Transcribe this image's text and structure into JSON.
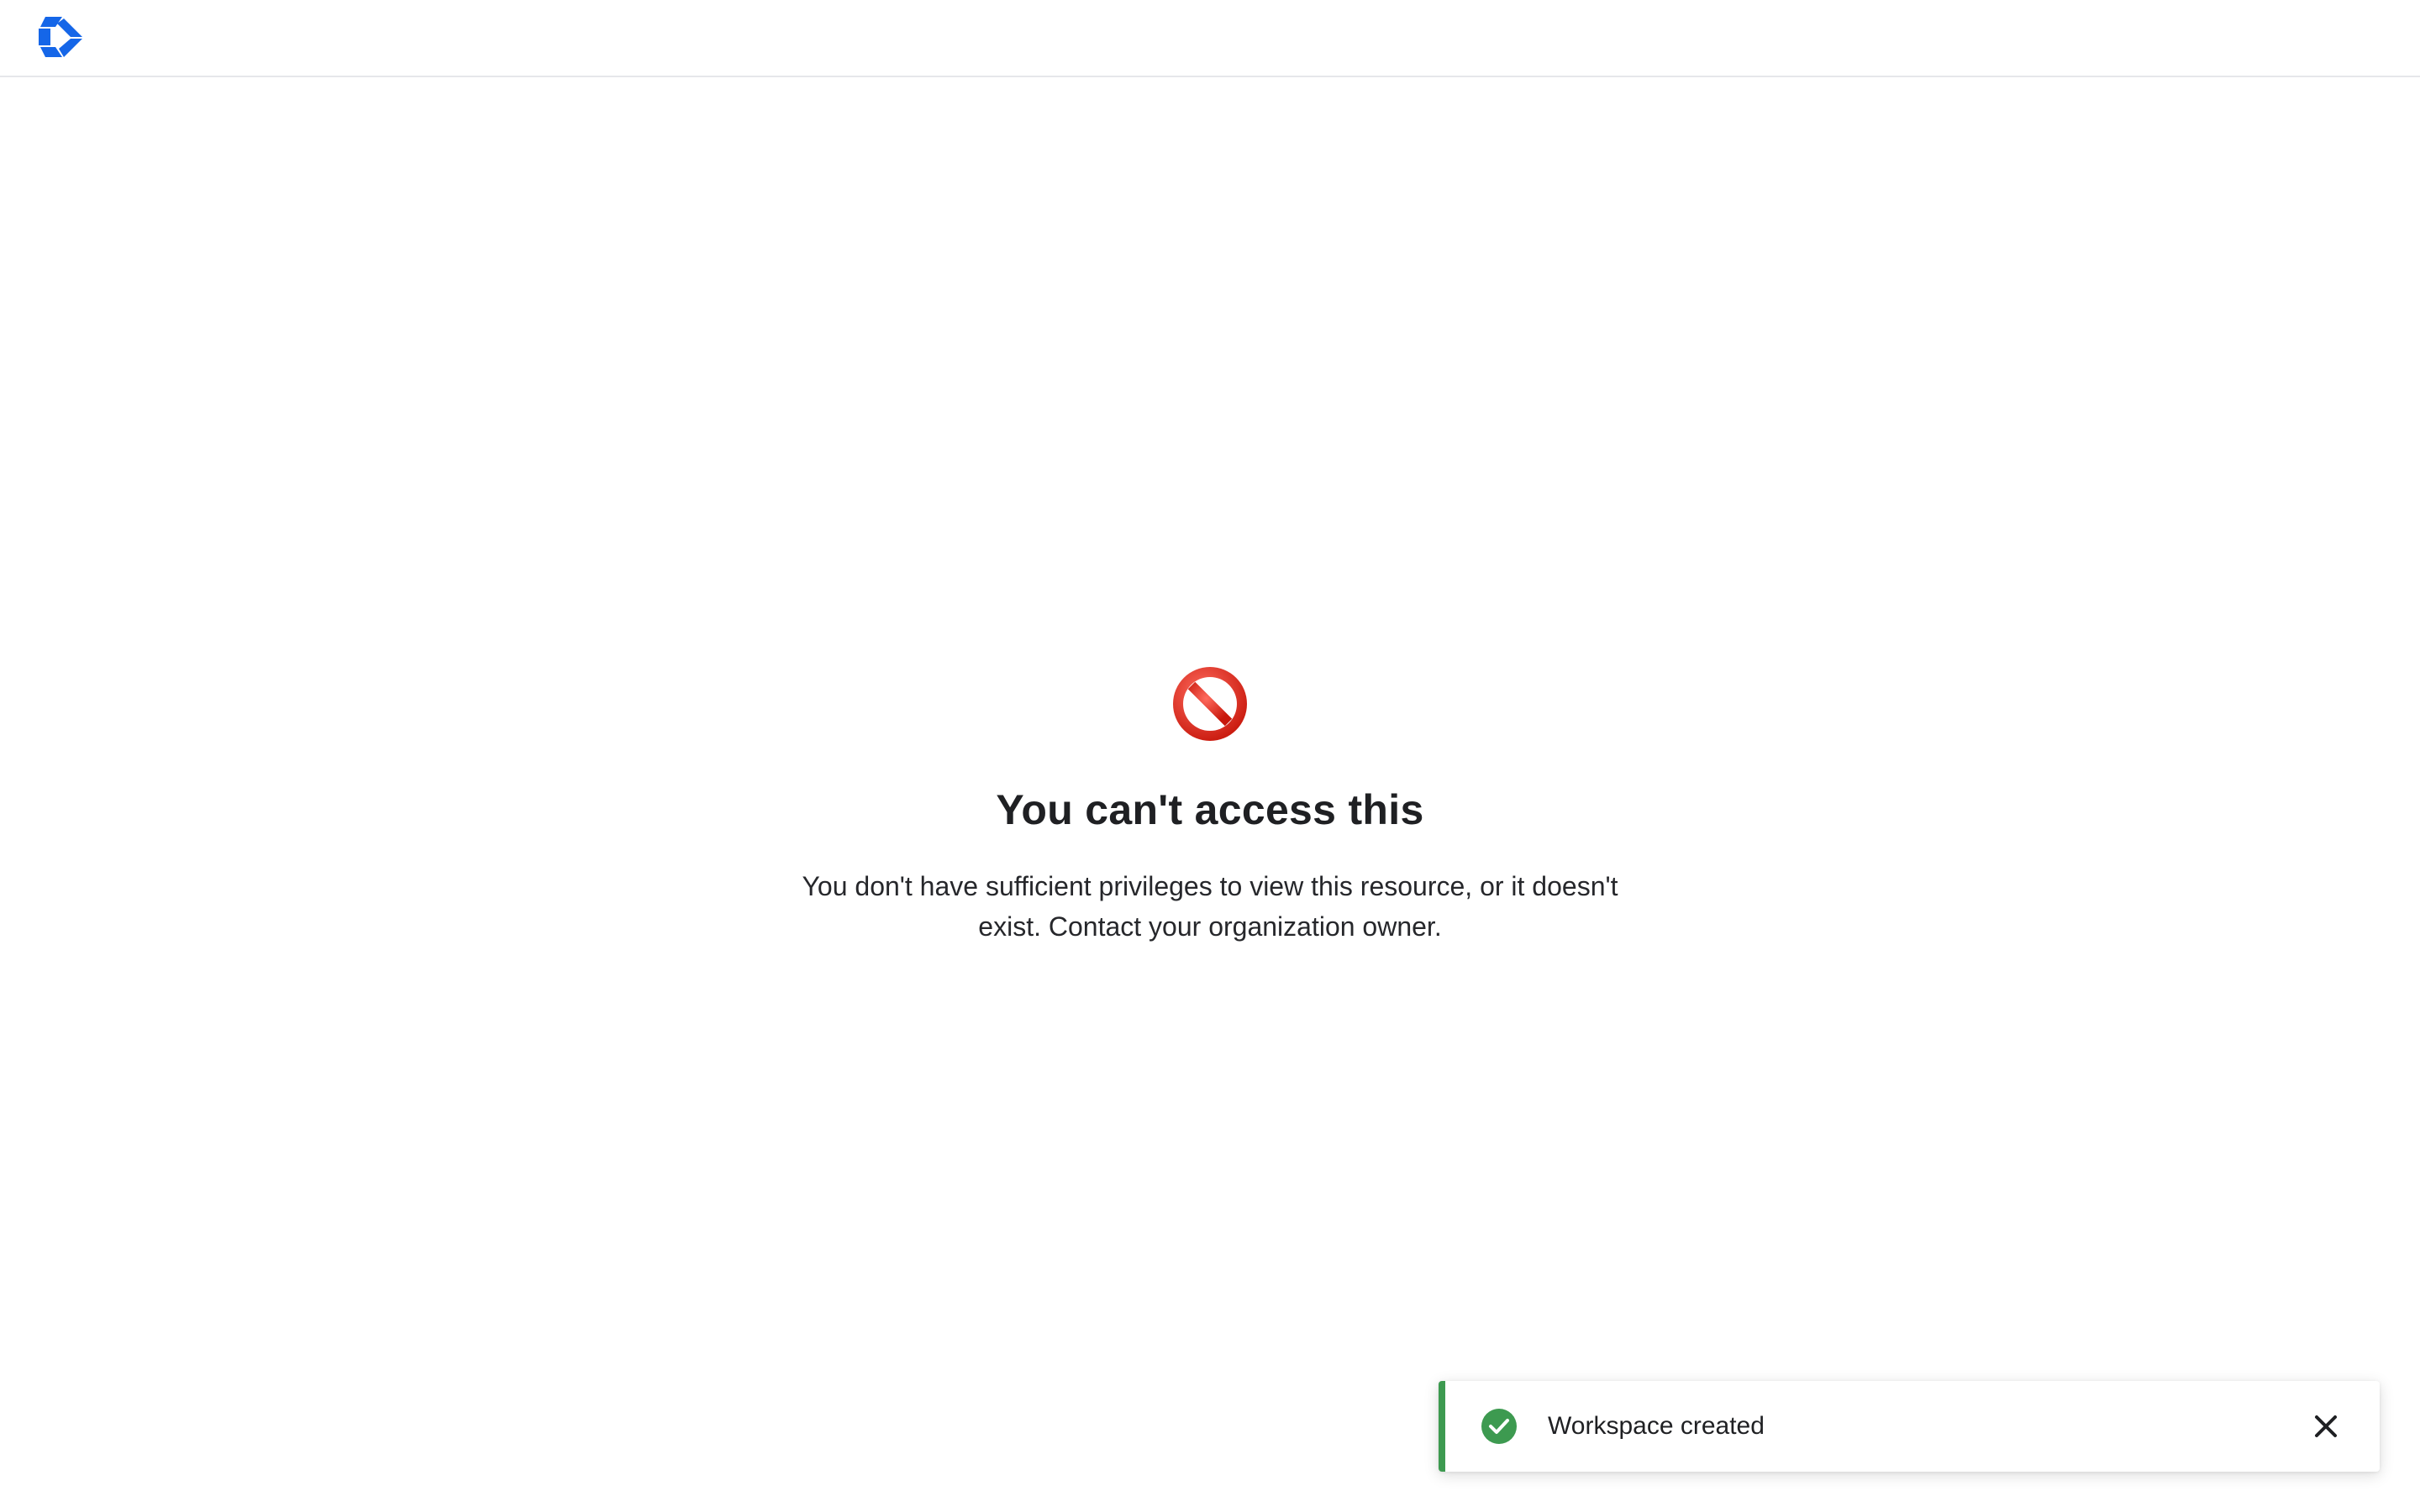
{
  "header": {
    "logo_icon": "brand-logo-icon",
    "brand_color": "#1566e8"
  },
  "error": {
    "icon": "no-entry-icon",
    "title": "You can't access this",
    "message": "You don't have sufficient privileges to view this resource, or it doesn't exist. Contact your organization owner."
  },
  "toast": {
    "status_icon": "check-circle-icon",
    "text": "Workspace created",
    "close_icon": "close-icon",
    "accent_color": "#3d9a50"
  }
}
